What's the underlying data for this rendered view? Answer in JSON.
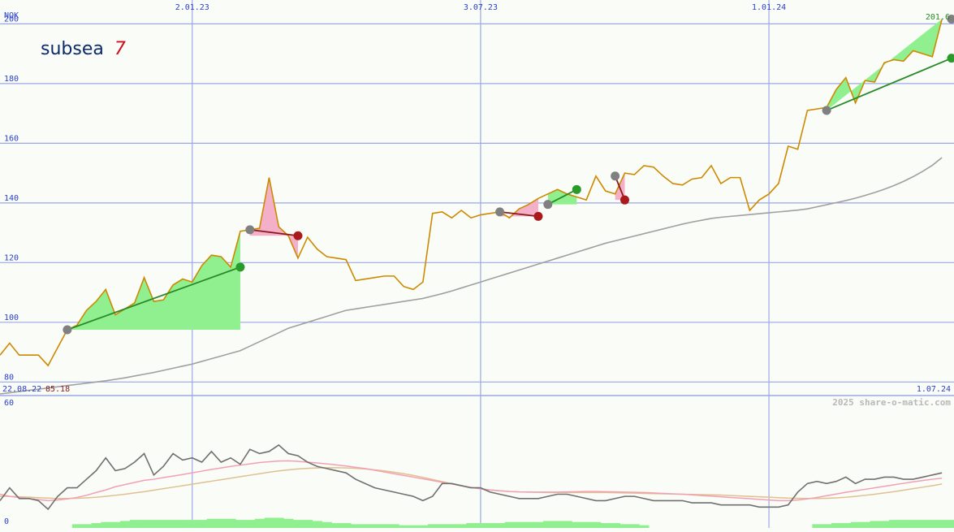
{
  "colors": {
    "background": "#fafcf7",
    "grid": "#9aa8e8",
    "axis_text": "#2a3fc9",
    "price_line": "#cc8a00",
    "moving_average": "#a0a0a0",
    "fill_gain": "#90f090",
    "fill_loss": "#f4b0c8",
    "trend_gain": "#2a8a2a",
    "trend_loss": "#8a1a1a",
    "dot_start": "#808080",
    "dot_gain": "#2a9a2a",
    "dot_loss": "#aa1a1a",
    "last_value": "#2a8a2a",
    "start_value": "#8a1a1a",
    "logo_text": "#0a2a6a",
    "logo_digit": "#cc1020",
    "osc_main": "#707070",
    "osc_fast": "#f4a0b4",
    "osc_slow": "#e0c090",
    "volume": "#90f090",
    "watermark": "#b8b8b8"
  },
  "logo": {
    "text": "subsea",
    "digit": "7"
  },
  "header": {
    "currency": "NOK",
    "last_value": "201.6"
  },
  "footer": {
    "start_date": "22.08.22",
    "start_value": "85.18",
    "end_date": "1.07.24",
    "watermark": "2025 share-o-matic.com"
  },
  "chart_data": [
    {
      "type": "line",
      "ylabel": "NOK",
      "ylim": [
        76,
        208
      ],
      "xlim": [
        0,
        99
      ],
      "x_ticks": [
        {
          "x": 20,
          "label": "2.01.23"
        },
        {
          "x": 50,
          "label": "3.07.23"
        },
        {
          "x": 80,
          "label": "1.01.24"
        }
      ],
      "y_ticks": [
        80,
        100,
        120,
        140,
        160,
        180,
        200
      ],
      "grid": true,
      "series": [
        {
          "role": "price",
          "values": [
            89.0,
            93.0,
            89.0,
            89.0,
            89.0,
            85.5,
            91.5,
            97.5,
            99.0,
            104.0,
            107.0,
            111.0,
            102.5,
            104.5,
            106.5,
            115.0,
            107.0,
            107.5,
            112.5,
            114.5,
            113.5,
            119.0,
            122.5,
            122.0,
            118.5,
            130.5,
            131.0,
            131.5,
            148.5,
            132.0,
            129.0,
            121.5,
            128.5,
            124.5,
            122.0,
            121.5,
            121.0,
            114.0,
            114.5,
            115.0,
            115.5,
            115.5,
            112.0,
            111.0,
            113.5,
            136.5,
            137.0,
            135.0,
            137.5,
            135.0,
            136.0,
            136.5,
            137.0,
            135.0,
            138.0,
            139.5,
            141.5,
            143.0,
            144.5,
            143.0,
            142.0,
            141.0,
            149.0,
            144.0,
            143.0,
            150.0,
            149.5,
            152.5,
            152.0,
            149.0,
            146.5,
            146.0,
            148.0,
            148.5,
            152.5,
            146.5,
            148.5,
            148.5,
            137.5,
            141.0,
            143.0,
            146.5,
            159.0,
            158.0,
            171.0,
            171.5,
            172.0,
            178.0,
            182.0,
            173.5,
            181.0,
            180.5,
            187.0,
            188.0,
            187.5,
            191.0,
            190.0,
            189.0,
            201.6
          ]
        },
        {
          "role": "moving-average",
          "values": [
            76.0,
            76.4,
            76.8,
            77.2,
            77.6,
            78.0,
            78.4,
            78.8,
            79.2,
            79.6,
            80.0,
            80.4,
            80.9,
            81.4,
            82.0,
            82.6,
            83.2,
            83.9,
            84.6,
            85.3,
            86.0,
            86.9,
            87.8,
            88.7,
            89.6,
            90.5,
            92.0,
            93.5,
            95.0,
            96.5,
            98.0,
            99.0,
            100.0,
            101.0,
            102.0,
            103.0,
            104.0,
            104.5,
            105.0,
            105.5,
            106.0,
            106.5,
            107.0,
            107.5,
            108.0,
            108.8,
            109.6,
            110.5,
            111.5,
            112.5,
            113.5,
            114.5,
            115.5,
            116.5,
            117.5,
            118.5,
            119.5,
            120.5,
            121.5,
            122.5,
            123.5,
            124.5,
            125.5,
            126.5,
            127.3,
            128.1,
            128.9,
            129.7,
            130.5,
            131.3,
            132.1,
            132.9,
            133.6,
            134.2,
            134.8,
            135.2,
            135.5,
            135.8,
            136.1,
            136.4,
            136.7,
            137.0,
            137.3,
            137.6,
            138.0,
            138.7,
            139.4,
            140.1,
            140.8,
            141.6,
            142.5,
            143.5,
            144.6,
            145.8,
            147.2,
            148.8,
            150.6,
            152.6,
            155.2
          ]
        }
      ],
      "trend_segments": [
        {
          "from": 7,
          "to": 25,
          "from_value": 97.5,
          "to_value": 118.5,
          "direction": "gain"
        },
        {
          "from": 26,
          "to": 31,
          "from_value": 131.0,
          "to_value": 129.0,
          "direction": "loss"
        },
        {
          "from": 52,
          "to": 56,
          "from_value": 137.0,
          "to_value": 135.5,
          "direction": "loss"
        },
        {
          "from": 57,
          "to": 60,
          "from_value": 139.5,
          "to_value": 144.5,
          "direction": "gain"
        },
        {
          "from": 64,
          "to": 65,
          "from_value": 149.0,
          "to_value": 141.0,
          "direction": "loss"
        },
        {
          "from": 86,
          "to": 99,
          "from_value": 171.0,
          "to_value": 188.5,
          "direction": "gain"
        }
      ],
      "end_marker": {
        "x": 99,
        "value": 201.6
      }
    },
    {
      "type": "line",
      "ylim": [
        0,
        60
      ],
      "y_ticks": [
        0,
        60
      ],
      "grid": false,
      "series": [
        {
          "role": "oscillator",
          "values": [
            12,
            18,
            13,
            13,
            12,
            8,
            14,
            18,
            18,
            22,
            26,
            32,
            26,
            27,
            30,
            34,
            24,
            28,
            34,
            31,
            32,
            30,
            35,
            30,
            32,
            29,
            36,
            34,
            35,
            38,
            34,
            33,
            30,
            28,
            27,
            26,
            25,
            22,
            20,
            18,
            17,
            16,
            15,
            14,
            12,
            14,
            20,
            20,
            19,
            18,
            18,
            16,
            15,
            14,
            13,
            13,
            13,
            14,
            15,
            15,
            14,
            13,
            12,
            12,
            13,
            14,
            14,
            13,
            12,
            12,
            12,
            12,
            11,
            11,
            11,
            10,
            10,
            10,
            10,
            9,
            9,
            9,
            10,
            16,
            20,
            21,
            20,
            21,
            23,
            20,
            22,
            22,
            23,
            23,
            22,
            22,
            23,
            24,
            25
          ]
        },
        {
          "role": "fast-average",
          "values": [
            15,
            14,
            13.5,
            13,
            12.5,
            12,
            12.3,
            12.8,
            13.5,
            14.5,
            15.8,
            17,
            18.5,
            19.5,
            20.5,
            21.5,
            22,
            22.8,
            23.5,
            24.2,
            25,
            25.8,
            26.6,
            27.3,
            28,
            28.6,
            29.2,
            29.8,
            30.2,
            30.5,
            30.6,
            30.4,
            30,
            29.6,
            29.2,
            28.7,
            28.2,
            27.6,
            27,
            26.2,
            25.4,
            24.6,
            23.8,
            23,
            22.2,
            21.4,
            20.6,
            19.8,
            19,
            18.2,
            17.5,
            17,
            16.6,
            16.3,
            16.1,
            16,
            16,
            16,
            16,
            16.1,
            16.2,
            16.3,
            16.3,
            16.2,
            16.1,
            16,
            15.9,
            15.8,
            15.6,
            15.4,
            15.2,
            15,
            14.7,
            14.4,
            14.1,
            13.8,
            13.5,
            13.2,
            12.9,
            12.6,
            12.3,
            12,
            12,
            12.3,
            12.8,
            13.5,
            14.3,
            15.1,
            15.9,
            16.6,
            17.3,
            18,
            18.7,
            19.4,
            20.1,
            20.8,
            21.4,
            22,
            22.5
          ]
        },
        {
          "role": "slow-average",
          "values": [
            14,
            14,
            13.8,
            13.6,
            13.4,
            13.2,
            13,
            13,
            13.1,
            13.3,
            13.6,
            14,
            14.5,
            15,
            15.6,
            16.2,
            16.9,
            17.6,
            18.3,
            19,
            19.7,
            20.4,
            21.1,
            21.8,
            22.5,
            23.2,
            23.9,
            24.6,
            25.3,
            25.9,
            26.4,
            26.8,
            27.1,
            27.3,
            27.4,
            27.4,
            27.3,
            27.1,
            26.8,
            26.4,
            25.9,
            25.3,
            24.6,
            23.8,
            22.9,
            21.9,
            20.9,
            19.9,
            19,
            18.2,
            17.5,
            17,
            16.6,
            16.3,
            16.1,
            16,
            15.9,
            15.8,
            15.8,
            15.8,
            15.8,
            15.8,
            15.8,
            15.8,
            15.7,
            15.6,
            15.5,
            15.4,
            15.3,
            15.2,
            15.1,
            15,
            14.9,
            14.8,
            14.7,
            14.6,
            14.4,
            14.2,
            14,
            13.8,
            13.6,
            13.4,
            13.2,
            13.1,
            13,
            13,
            13.1,
            13.3,
            13.6,
            14,
            14.5,
            15,
            15.6,
            16.2,
            16.9,
            17.6,
            18.3,
            19,
            19.8
          ]
        },
        {
          "role": "volume",
          "values": [
            0,
            0,
            0,
            0,
            0,
            0,
            0,
            0,
            1,
            1,
            1.5,
            2,
            2,
            2.5,
            3,
            3,
            3,
            3,
            3,
            3,
            3,
            3,
            3.5,
            3.5,
            3.5,
            3,
            3,
            3.5,
            4,
            4,
            3.5,
            3,
            3,
            2.5,
            2,
            1.5,
            1.5,
            1,
            1,
            1,
            1,
            1,
            0.5,
            0.5,
            0.5,
            1,
            1,
            1,
            1,
            1.5,
            1.5,
            1.5,
            1.5,
            2,
            2,
            2,
            2,
            2.5,
            2.5,
            2.5,
            2,
            2,
            2,
            1.5,
            1.5,
            1,
            1,
            0.5,
            0,
            0,
            0,
            0,
            0,
            0,
            0,
            0,
            0,
            0,
            0,
            0,
            0,
            0,
            0,
            0,
            0,
            1,
            1,
            1.5,
            1.5,
            2,
            2,
            2.5,
            2.5,
            3,
            3,
            3,
            3,
            3,
            3,
            3
          ]
        }
      ]
    }
  ]
}
